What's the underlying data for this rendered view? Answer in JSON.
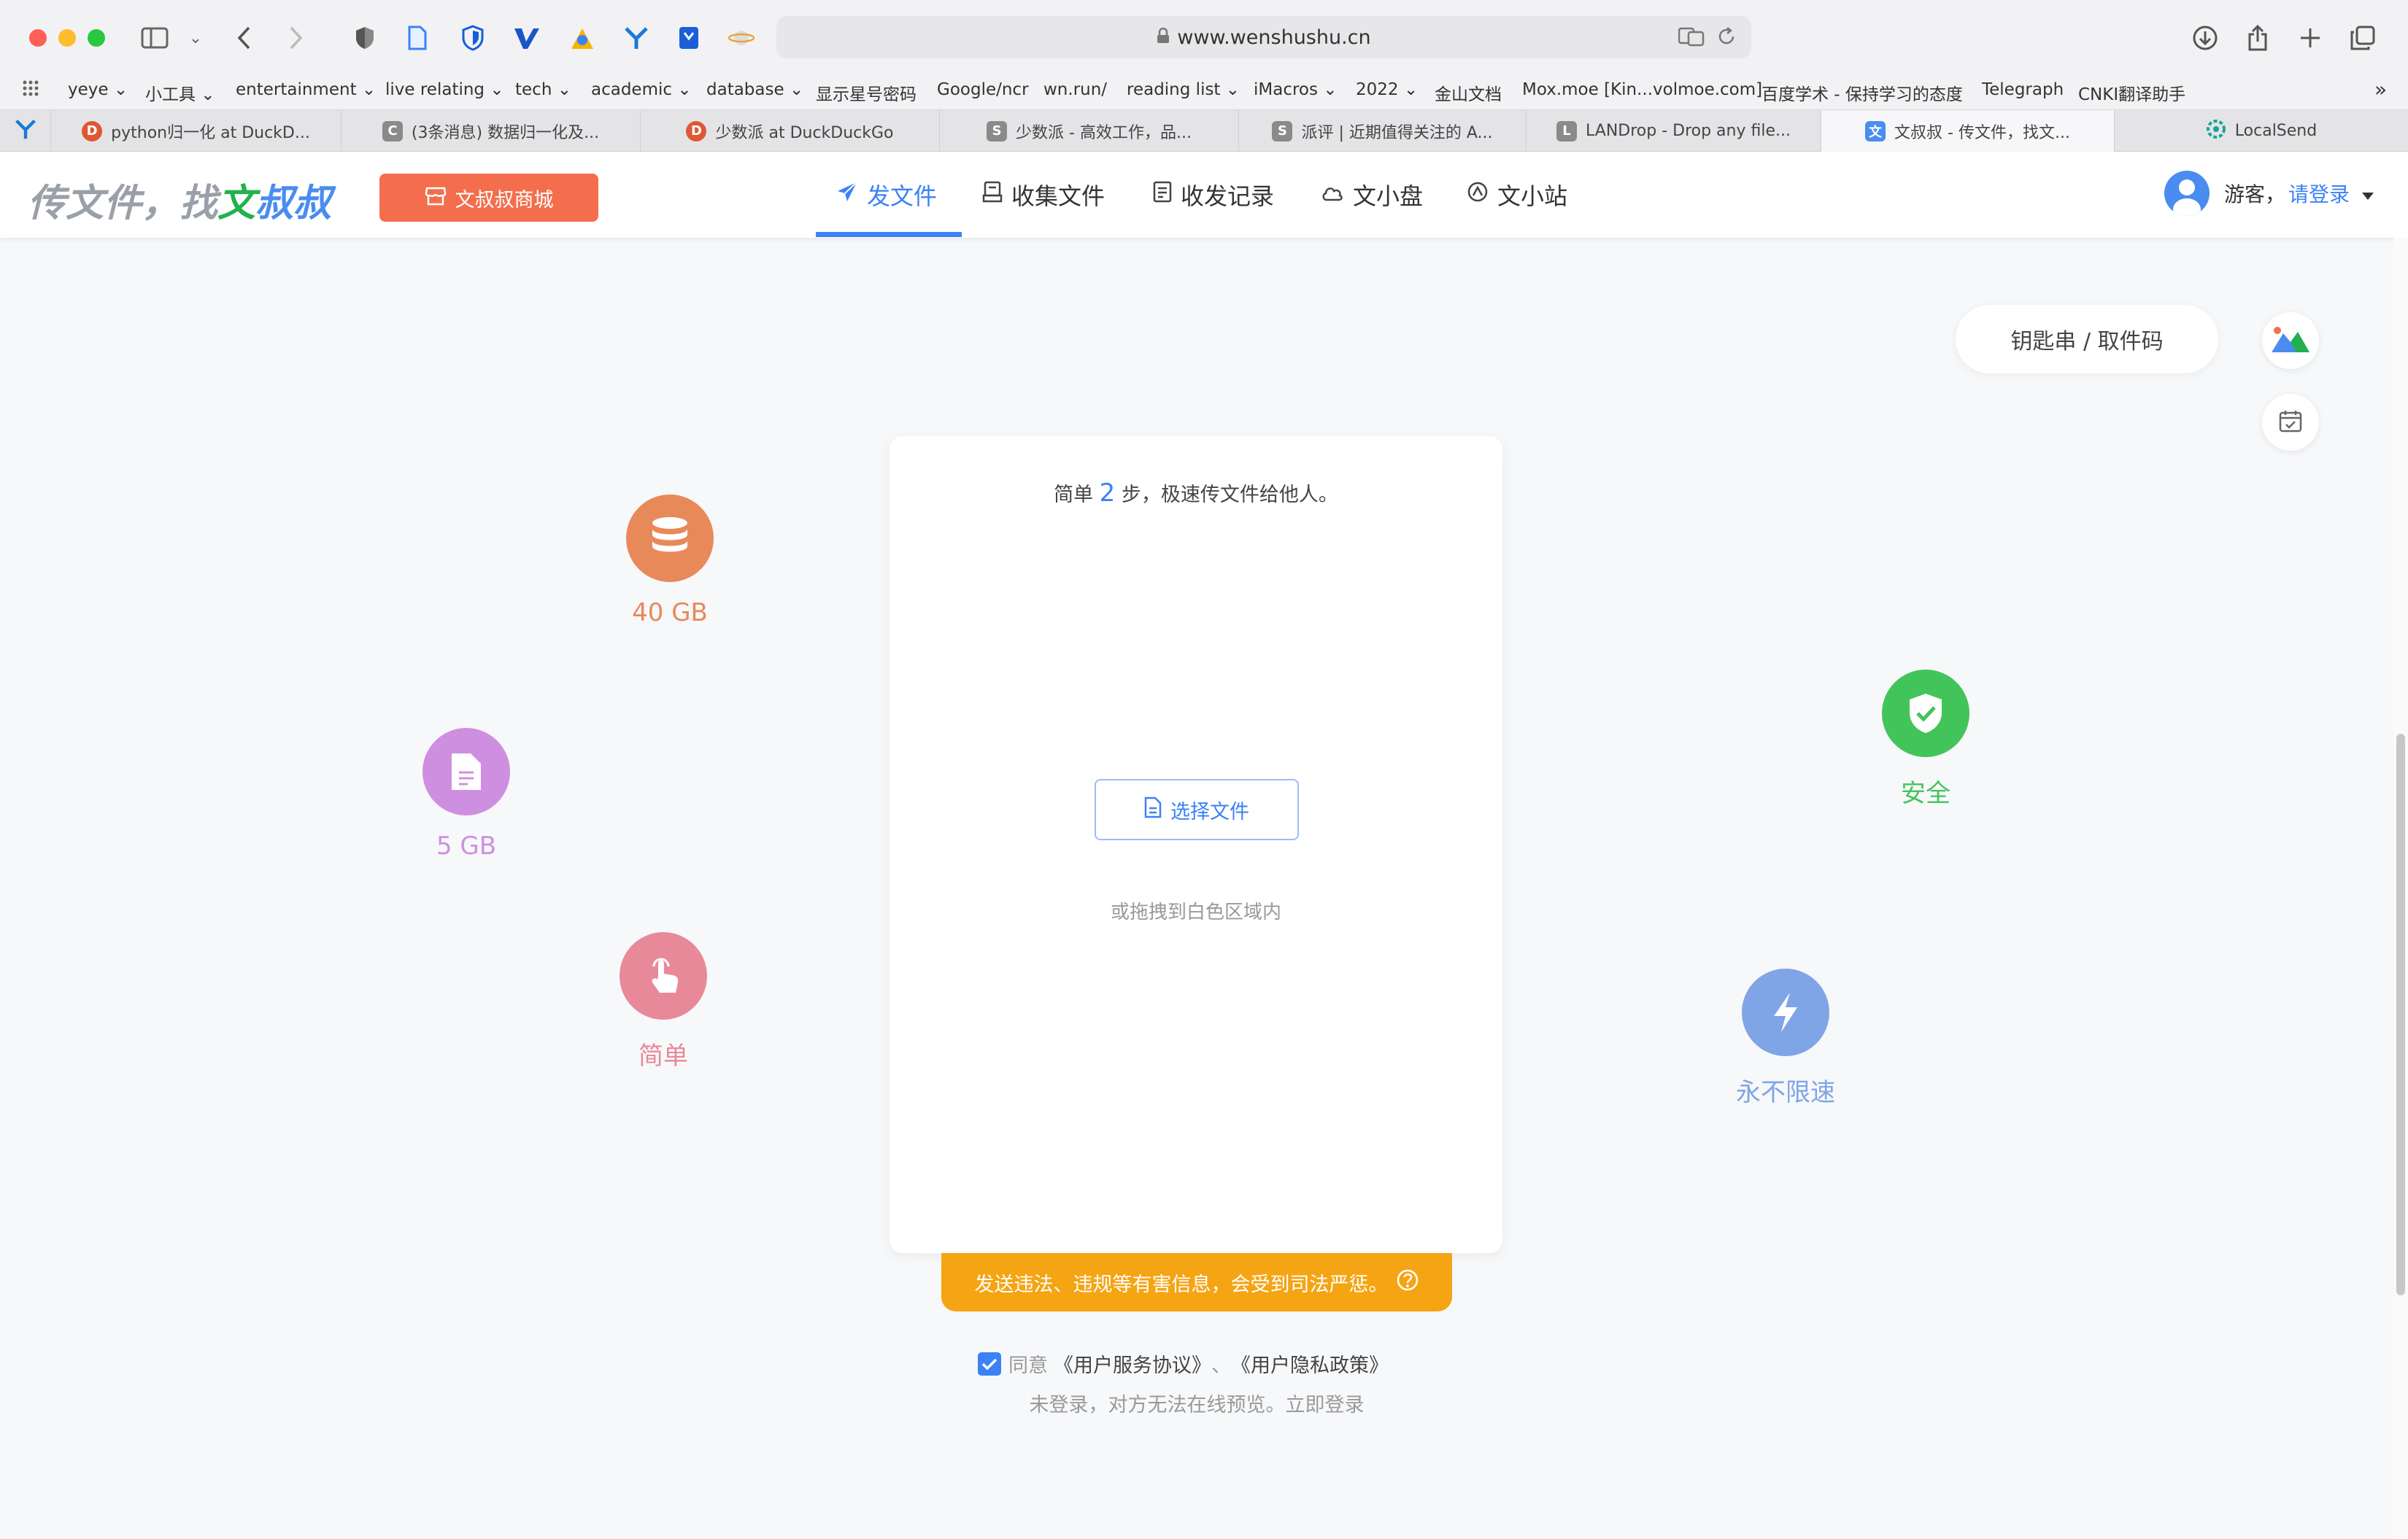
{
  "browser": {
    "url": "www.wenshushu.cn",
    "bookmarks": [
      "yeye",
      "小工具",
      "entertainment",
      "live relating",
      "tech",
      "academic",
      "database",
      "显示星号密码",
      "Google/ncr",
      "wn.run/",
      "reading list",
      "iMacros",
      "2022",
      "金山文档",
      "Mox.moe [Kin...volmoe.com]",
      "百度学术 - 保持学习的态度",
      "Telegraph",
      "CNKI翻译助手"
    ],
    "tabs": [
      {
        "label": "python归一化 at DuckD...",
        "icon": "duckduckgo-icon",
        "color": "#de5833",
        "letter": "D"
      },
      {
        "label": "(3条消息) 数据归一化及...",
        "icon": "csdn-icon",
        "color": "#8a8a8a",
        "letter": "C"
      },
      {
        "label": "少数派 at DuckDuckGo",
        "icon": "duckduckgo-icon",
        "color": "#de5833",
        "letter": "D"
      },
      {
        "label": "少数派 - 高效工作，品...",
        "icon": "sspai-icon",
        "color": "#8a8a8a",
        "letter": "S"
      },
      {
        "label": "派评 | 近期值得关注的 A...",
        "icon": "sspai-icon",
        "color": "#8a8a8a",
        "letter": "S"
      },
      {
        "label": "LANDrop - Drop any file...",
        "icon": "landrop-icon",
        "color": "#8a8a8a",
        "letter": "L"
      },
      {
        "label": "文叔叔 - 传文件，找文...",
        "icon": "wenshushu-icon",
        "color": "#4a8cf0",
        "letter": "文"
      },
      {
        "label": "LocalSend",
        "icon": "localsend-icon",
        "color": "#1aa39a",
        "letter": "◎"
      }
    ]
  },
  "site": {
    "logo": {
      "prefix": "传文件，找",
      "wen": "文",
      "shushu": "叔叔"
    },
    "shop_label": "文叔叔商城",
    "nav": [
      "发文件",
      "收集文件",
      "收发记录",
      "文小盘",
      "文小站"
    ],
    "user": {
      "guest": "游客，",
      "login": "请登录"
    }
  },
  "main": {
    "key_button": "钥匙串 / 取件码",
    "features": [
      {
        "label": "40 GB",
        "color": "#e8895a",
        "icon": "database-icon"
      },
      {
        "label": "5 GB",
        "color": "#cf8fe0",
        "icon": "file-icon"
      },
      {
        "label": "简单",
        "color": "#e8899a",
        "icon": "pointer-hand-icon"
      },
      {
        "label": "安全",
        "color": "#43c45a",
        "icon": "shield-check-icon"
      },
      {
        "label": "永不限速",
        "color": "#7fa5e6",
        "icon": "lightning-icon"
      }
    ],
    "card": {
      "title_pre": "简单 ",
      "title_num": "2",
      "title_post": " 步，极速传文件给他人。",
      "select_button": "选择文件",
      "drag_hint": "或拖拽到白色区域内"
    },
    "warning": "发送违法、违规等有害信息，会受到司法严惩。",
    "agree": {
      "prefix": "同意",
      "terms": "《用户服务协议》",
      "sep": "、",
      "privacy": "《用户隐私政策》"
    },
    "note": "未登录，对方无法在线预览。立即登录"
  }
}
